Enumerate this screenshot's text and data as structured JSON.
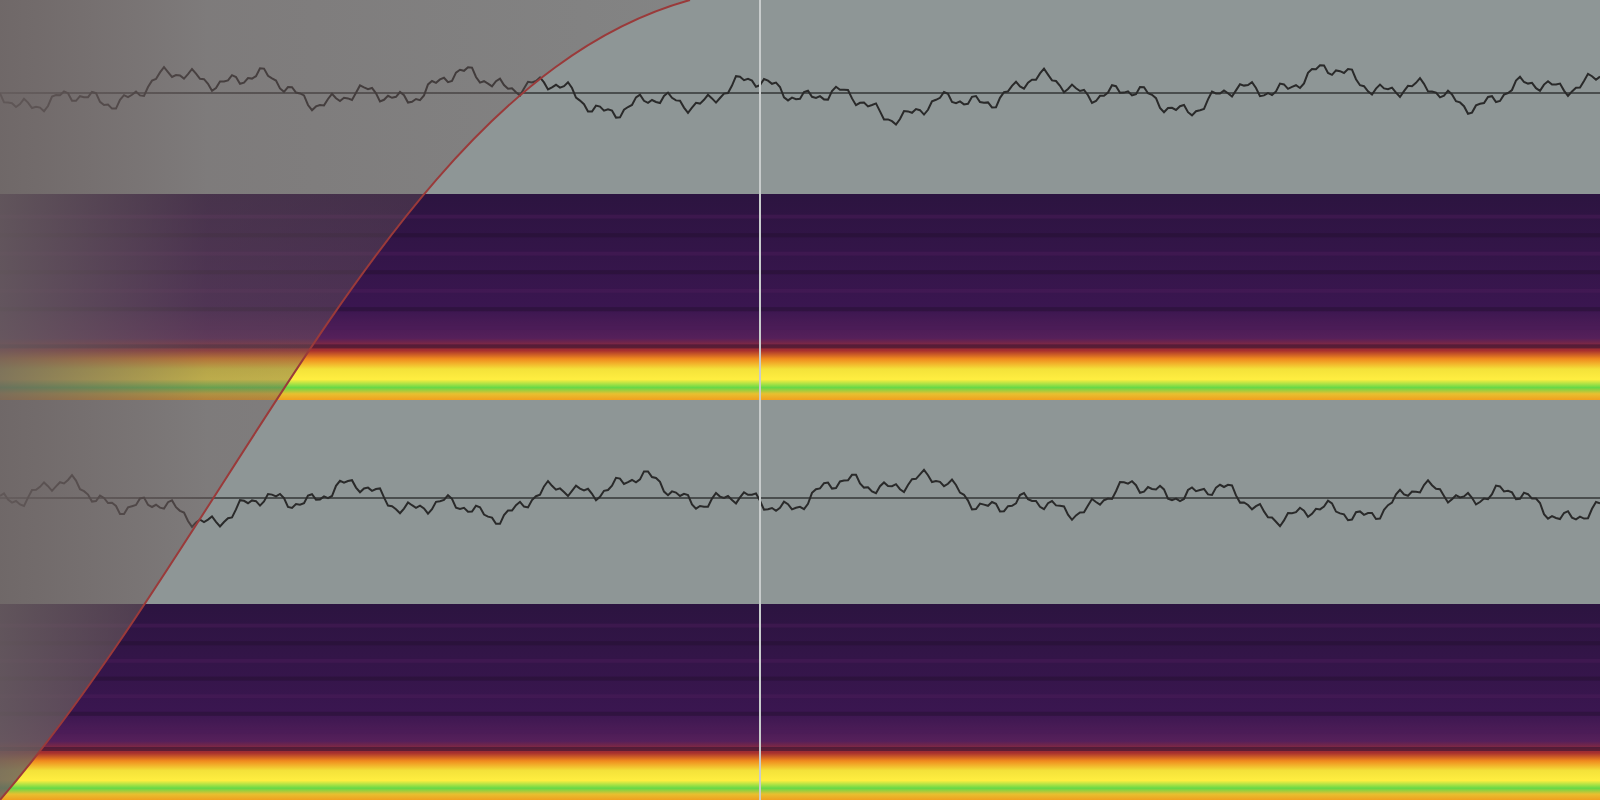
{
  "lanes": [
    {
      "kind": "waveform"
    },
    {
      "kind": "spectrogram"
    },
    {
      "kind": "waveform"
    },
    {
      "kind": "spectrogram"
    }
  ],
  "fade_in": {
    "kind": "curve"
  },
  "playhead": {
    "kind": "line"
  }
}
